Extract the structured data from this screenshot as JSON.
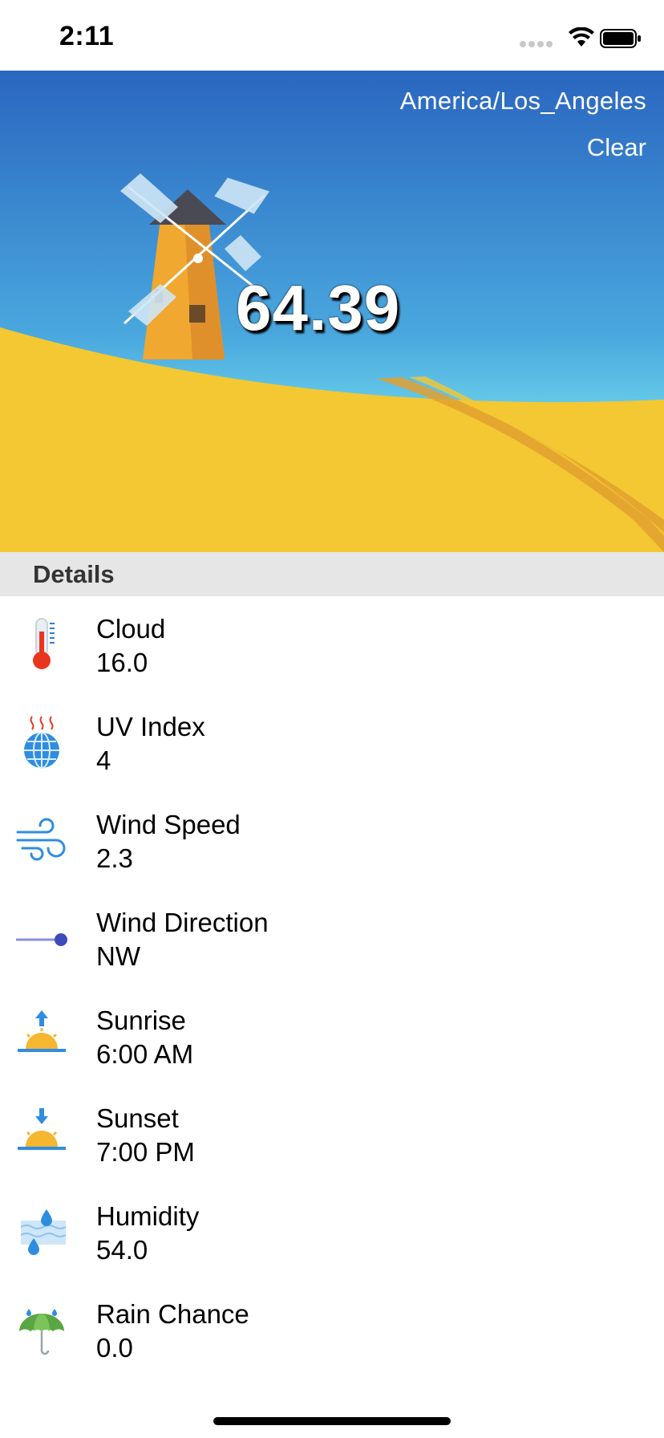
{
  "status_bar": {
    "time": "2:11"
  },
  "hero": {
    "timezone": "America/Los_Angeles",
    "condition": "Clear",
    "temperature": "64.39",
    "colors": {
      "sky_top": "#2a66c0",
      "sky_bottom": "#6fd6ec",
      "field": "#f3c832",
      "path": "#e2a030"
    }
  },
  "details": {
    "header": "Details",
    "items": [
      {
        "label": "Cloud",
        "value": "16.0",
        "icon": "thermometer-icon"
      },
      {
        "label": "UV Index",
        "value": "4",
        "icon": "globe-heat-icon"
      },
      {
        "label": "Wind Speed",
        "value": "2.3",
        "icon": "wind-icon"
      },
      {
        "label": "Wind Direction",
        "value": "NW",
        "icon": "wind-direction-icon"
      },
      {
        "label": "Sunrise",
        "value": "6:00 AM",
        "icon": "sunrise-icon"
      },
      {
        "label": "Sunset",
        "value": "7:00 PM",
        "icon": "sunset-icon"
      },
      {
        "label": "Humidity",
        "value": "54.0",
        "icon": "humidity-icon"
      },
      {
        "label": "Rain Chance",
        "value": "0.0",
        "icon": "umbrella-icon"
      }
    ]
  }
}
